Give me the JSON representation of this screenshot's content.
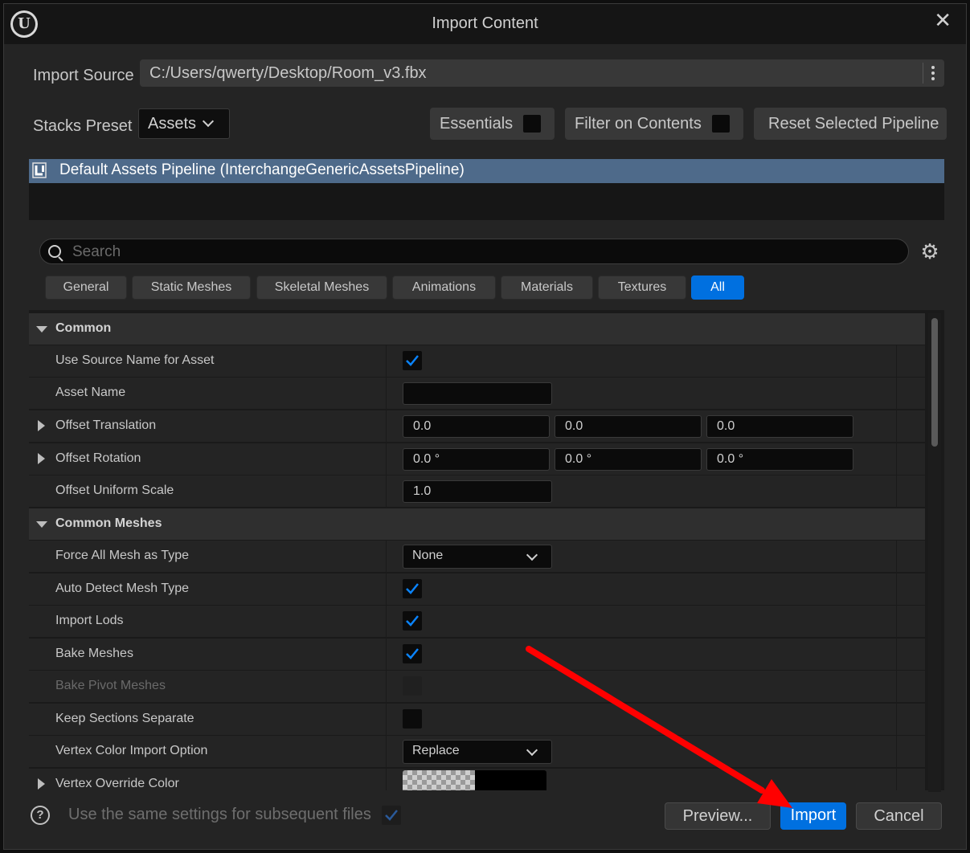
{
  "window": {
    "title": "Import Content"
  },
  "import_source": {
    "label": "Import Source",
    "value": "C:/Users/qwerty/Desktop/Room_v3.fbx"
  },
  "stacks_preset": {
    "label": "Stacks Preset",
    "value": "Assets"
  },
  "toolbar": {
    "essentials": {
      "label": "Essentials",
      "checked": false
    },
    "filter_on_contents": {
      "label": "Filter on Contents",
      "checked": false
    },
    "reset_label": "Reset Selected Pipeline"
  },
  "pipelines": [
    {
      "label": "Default Assets Pipeline (InterchangeGenericAssetsPipeline)",
      "selected": true
    }
  ],
  "search": {
    "placeholder": "Search"
  },
  "tabs": [
    {
      "label": "General"
    },
    {
      "label": "Static Meshes"
    },
    {
      "label": "Skeletal Meshes"
    },
    {
      "label": "Animations"
    },
    {
      "label": "Materials"
    },
    {
      "label": "Textures"
    },
    {
      "label": "All",
      "active": true
    }
  ],
  "sections": {
    "common": {
      "title": "Common",
      "use_source_name": {
        "label": "Use Source Name for Asset",
        "checked": true
      },
      "asset_name": {
        "label": "Asset Name",
        "value": ""
      },
      "offset_translation": {
        "label": "Offset Translation",
        "x": "0.0",
        "y": "0.0",
        "z": "0.0"
      },
      "offset_rotation": {
        "label": "Offset Rotation",
        "x": "0.0 °",
        "y": "0.0 °",
        "z": "0.0 °"
      },
      "offset_uniform_scale": {
        "label": "Offset Uniform Scale",
        "value": "1.0"
      }
    },
    "common_meshes": {
      "title": "Common Meshes",
      "force_all_mesh": {
        "label": "Force All Mesh as Type",
        "value": "None"
      },
      "auto_detect": {
        "label": "Auto Detect Mesh Type",
        "checked": true
      },
      "import_lods": {
        "label": "Import Lods",
        "checked": true
      },
      "bake_meshes": {
        "label": "Bake Meshes",
        "checked": true
      },
      "bake_pivot": {
        "label": "Bake Pivot Meshes",
        "checked": false,
        "disabled": true
      },
      "keep_sections": {
        "label": "Keep Sections Separate",
        "checked": false
      },
      "vertex_color_option": {
        "label": "Vertex Color Import Option",
        "value": "Replace"
      },
      "vertex_override_color": {
        "label": "Vertex Override Color",
        "color": "#000000"
      }
    }
  },
  "footer": {
    "same_settings_label": "Use the same settings for subsequent files",
    "same_settings_checked": true,
    "preview_label": "Preview...",
    "import_label": "Import",
    "cancel_label": "Cancel"
  },
  "colors": {
    "accent": "#0070e0",
    "selection": "#4e6a8a",
    "annotation_arrow": "#ff0000"
  }
}
